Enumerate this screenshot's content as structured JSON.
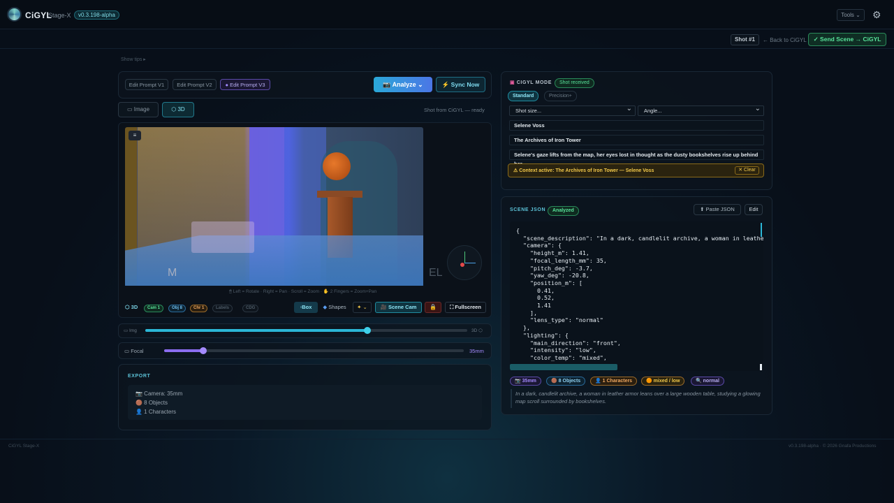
{
  "app": {
    "name": "CiGYL",
    "stage": "Stage-X",
    "version": "v0.3.198-alpha"
  },
  "topbar": {
    "tools_label": "Tools ⌄",
    "settings_icon": "gear-icon"
  },
  "subbar": {
    "shot_label": "Shot #1",
    "back_label": "← Back to CiGYL",
    "send_label": "✓ Send Scene → CiGYL"
  },
  "show_tips": "Show tips ▸",
  "editor": {
    "prompt_tabs": [
      "Edit Prompt V1",
      "Edit Prompt V2",
      "Edit Prompt V3"
    ],
    "active_prompt": "Edit Prompt V3",
    "analyze_label": "Analyze ⌄",
    "sync_label": "Sync Now",
    "view_tabs": [
      "Image",
      "3D"
    ],
    "active_view": "3D",
    "shot_status": "Shot from CiGYL — ready",
    "viewport_hint": "🖱 Left = Rotate · Right = Pan · Scroll = Zoom · ✋ 2 Fingers = Zoom+Pan",
    "wall_letters": [
      "M",
      "EL"
    ],
    "toolbar": {
      "mode_label": "3D",
      "toggles": [
        "Cam 1",
        "Obj 8",
        "Chr 1",
        "Labels",
        "CDG"
      ],
      "box_label": "Box",
      "shapes_label": "Shapes",
      "magic_label": "✦ ⌄",
      "scene_cam_label": "Scene Cam",
      "fullscreen_label": "Fullscreen"
    },
    "mode_slider": {
      "left": "Img",
      "right": "3D",
      "value": 0.69
    },
    "focal": {
      "label": "Focal",
      "value_label": "35mm",
      "value": 0.13
    }
  },
  "export": {
    "title": "EXPORT",
    "lines": [
      "📷 Camera: 35mm",
      "🟤 8 Objects",
      "👤 1 Characters"
    ]
  },
  "cigyl_mode": {
    "title": "CIGYL MODE",
    "status": "Shot received",
    "modes": [
      "Standard",
      "Precision+"
    ],
    "active_mode": "Standard",
    "shot_size": "Shot size...",
    "angle": "Angle...",
    "character": "Selene Voss",
    "location": "The Archives of Iron Tower",
    "action": "Selene's gaze lifts from the map, her eyes lost in thought as the dusty bookshelves rise up behind her",
    "context": "⚠ Context active: The Archives of Iron Tower — Selene Voss",
    "clear_label": "✕ Clear"
  },
  "scene_json": {
    "title": "SCENE JSON",
    "status": "Analyzed",
    "paste_label": "⬆ Paste JSON",
    "edit_label": "Edit",
    "code": "{\n  \"scene_description\": \"In a dark, candlelit archive, a woman in leather\n  \"camera\": {\n    \"height_m\": 1.41,\n    \"focal_length_mm\": 35,\n    \"pitch_deg\": -3.7,\n    \"yaw_deg\": -20.8,\n    \"position_m\": [\n      0.41,\n      0.52,\n      1.41\n    ],\n    \"lens_type\": \"normal\"\n  },\n  \"lighting\": {\n    \"main_direction\": \"front\",\n    \"intensity\": \"low\",\n    \"color_temp\": \"mixed\",",
    "tags": [
      "📷 35mm",
      "🟤 8 Objects",
      "👤 1 Characters",
      "🟠 mixed / low",
      "🔍 normal"
    ],
    "description": "In a dark, candlelit archive, a woman in leather armor leans over a large wooden table, studying a glowing map scroll surrounded by bookshelves."
  },
  "footer": {
    "left": "CiGYL Stage-X",
    "right": "v0.3.198-alpha · © 2026 Gnafa Productions"
  },
  "colors": {
    "accent": "#2bb6d6",
    "green": "#4fd694",
    "purple": "#8b6df0"
  }
}
